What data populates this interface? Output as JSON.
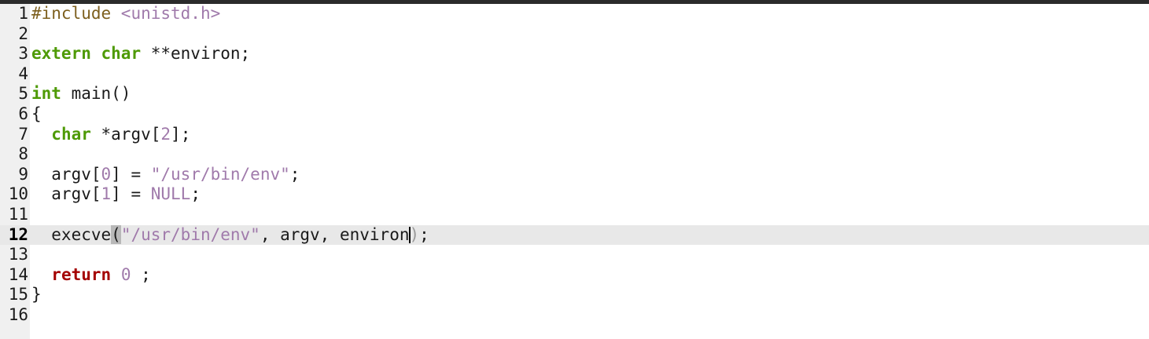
{
  "editor": {
    "language": "c",
    "current_line": 12,
    "lines": [
      {
        "n": "1",
        "tokens": [
          {
            "t": "#include ",
            "k": "pre"
          },
          {
            "t": "<unistd.h>",
            "k": "inc"
          }
        ]
      },
      {
        "n": "2",
        "tokens": []
      },
      {
        "n": "3",
        "tokens": [
          {
            "t": "extern",
            "k": "kw"
          },
          {
            "t": " ",
            "k": "plain"
          },
          {
            "t": "char",
            "k": "kw"
          },
          {
            "t": " **environ;",
            "k": "plain"
          }
        ]
      },
      {
        "n": "4",
        "tokens": []
      },
      {
        "n": "5",
        "tokens": [
          {
            "t": "int",
            "k": "kw"
          },
          {
            "t": " main()",
            "k": "plain"
          }
        ]
      },
      {
        "n": "6",
        "tokens": [
          {
            "t": "{",
            "k": "plain"
          }
        ]
      },
      {
        "n": "7",
        "tokens": [
          {
            "t": "  ",
            "k": "plain"
          },
          {
            "t": "char",
            "k": "kw"
          },
          {
            "t": " *argv[",
            "k": "plain"
          },
          {
            "t": "2",
            "k": "num"
          },
          {
            "t": "];",
            "k": "plain"
          }
        ]
      },
      {
        "n": "8",
        "tokens": []
      },
      {
        "n": "9",
        "tokens": [
          {
            "t": "  argv[",
            "k": "plain"
          },
          {
            "t": "0",
            "k": "num"
          },
          {
            "t": "] = ",
            "k": "plain"
          },
          {
            "t": "\"/usr/bin/env\"",
            "k": "str"
          },
          {
            "t": ";",
            "k": "plain"
          }
        ]
      },
      {
        "n": "10",
        "tokens": [
          {
            "t": "  argv[",
            "k": "plain"
          },
          {
            "t": "1",
            "k": "num"
          },
          {
            "t": "] = ",
            "k": "plain"
          },
          {
            "t": "NULL",
            "k": "const"
          },
          {
            "t": ";",
            "k": "plain"
          }
        ]
      },
      {
        "n": "11",
        "tokens": []
      },
      {
        "n": "12",
        "tokens": [
          {
            "t": "  execve",
            "k": "plain"
          },
          {
            "t": "(",
            "k": "paren-hl"
          },
          {
            "t": "\"/usr/bin/env\"",
            "k": "str"
          },
          {
            "t": ", argv, environ",
            "k": "plain"
          },
          {
            "t": "",
            "k": "caret"
          },
          {
            "t": ")",
            "k": "paren-close"
          },
          {
            "t": ";",
            "k": "plain"
          }
        ]
      },
      {
        "n": "13",
        "tokens": []
      },
      {
        "n": "14",
        "tokens": [
          {
            "t": "  ",
            "k": "plain"
          },
          {
            "t": "return",
            "k": "ret"
          },
          {
            "t": " ",
            "k": "plain"
          },
          {
            "t": "0",
            "k": "num"
          },
          {
            "t": " ;",
            "k": "plain"
          }
        ]
      },
      {
        "n": "15",
        "tokens": [
          {
            "t": "}",
            "k": "plain"
          }
        ]
      },
      {
        "n": "16",
        "tokens": []
      }
    ]
  }
}
